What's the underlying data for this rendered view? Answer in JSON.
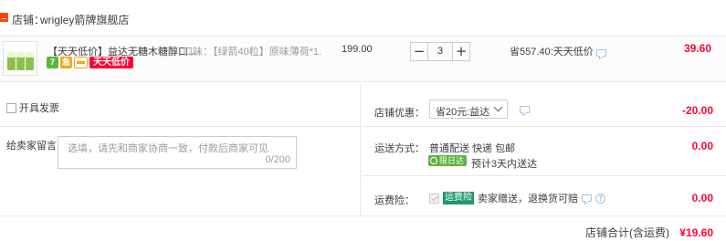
{
  "shop": {
    "label": "店铺：",
    "name": "wrigley箭牌旗舰店"
  },
  "item": {
    "title": "【天天低价】益达无糖木糖醇口...",
    "sku": "口味：【绿箭40粒】原味薄荷*1.",
    "badges": [
      "7",
      "急"
    ],
    "promo_badge": "天天低价",
    "unit_price": "199.00",
    "quantity": "3",
    "qty_minus": "−",
    "qty_plus": "+",
    "discount": "省557.40:天天低价",
    "total": "39.60",
    "colors": {
      "accent": "#ff0036",
      "badge_green": "#5bb53e"
    }
  },
  "invoice": {
    "label": "开具发票"
  },
  "message": {
    "label": "给卖家留言：",
    "placeholder": "选填，请先和商家协商一致，付款后商家可见",
    "counter": "0/200"
  },
  "coupon": {
    "label": "店铺优惠：",
    "selected": "省20元:益达",
    "amount": "-20.00"
  },
  "shipping": {
    "label": "运送方式：",
    "method": "普通配送 快递 包邮",
    "tag": "限日达",
    "eta": "预计3天内送达",
    "amount": "0.00"
  },
  "insurance": {
    "label": "运费险：",
    "tag": "运费险",
    "text": "卖家赠送，退换货可赔",
    "amount": "0.00"
  },
  "footer": {
    "label": "店铺合计(含运费)",
    "total": "¥19.60"
  }
}
